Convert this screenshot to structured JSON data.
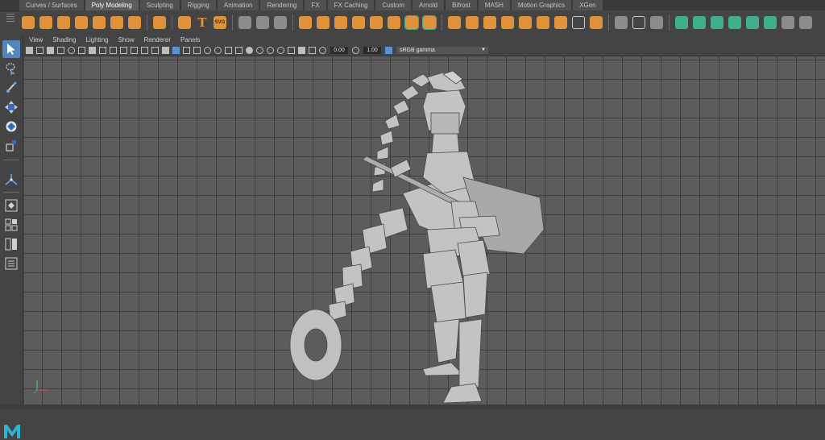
{
  "shelf_tabs": [
    {
      "label": "Curves / Surfaces",
      "active": false
    },
    {
      "label": "Poly Modeling",
      "active": true
    },
    {
      "label": "Sculpting",
      "active": false
    },
    {
      "label": "Rigging",
      "active": false
    },
    {
      "label": "Animation",
      "active": false
    },
    {
      "label": "Rendering",
      "active": false
    },
    {
      "label": "FX",
      "active": false
    },
    {
      "label": "FX Caching",
      "active": false
    },
    {
      "label": "Custom",
      "active": false
    },
    {
      "label": "Arnold",
      "active": false
    },
    {
      "label": "Bifrost",
      "active": false
    },
    {
      "label": "MASH",
      "active": false
    },
    {
      "label": "Motion Graphics",
      "active": false
    },
    {
      "label": "XGen",
      "active": false
    }
  ],
  "shelf": {
    "text_tool_glyph": "T",
    "svg_tool_label": "SVG",
    "icon_names": [
      "poly-sphere-icon",
      "poly-cube-icon",
      "poly-cylinder-icon",
      "poly-cone-icon",
      "poly-torus-icon",
      "poly-plane-icon",
      "poly-disc-icon",
      "platonic-solid-icon",
      "super-shape-icon",
      "sweep-mesh-icon",
      "type-tool-icon",
      "svg-tool-icon",
      "combine-icon",
      "separate-icon",
      "smooth-icon",
      "extract-icon",
      "booleans-icon",
      "mirror-icon",
      "bevel-icon",
      "extrude-icon",
      "bridge-icon",
      "multicut-icon",
      "target-weld-icon",
      "quad-draw-icon"
    ],
    "colors": {
      "orange": "#e0923a",
      "green": "#3fae8c"
    }
  },
  "panel_menu": [
    "View",
    "Shading",
    "Lighting",
    "Show",
    "Renderer",
    "Panels"
  ],
  "panel_toolbar": {
    "exposure": "0.00",
    "gamma": "1.00",
    "color_space": "sRGB gamma"
  },
  "toolbox": {
    "tools": [
      "select-tool-icon",
      "lasso-tool-icon",
      "paint-select-icon",
      "move-tool-icon",
      "rotate-tool-icon",
      "scale-tool-icon"
    ],
    "layout_buttons": [
      "single-pane-icon",
      "four-pane-icon",
      "two-pane-icon",
      "outliner-layout-icon"
    ],
    "accent": "#5287bd"
  },
  "viewport": {
    "grid_visible": true,
    "background": "#5c5c5c",
    "gizmo_axes": [
      "x",
      "y",
      "z"
    ]
  }
}
